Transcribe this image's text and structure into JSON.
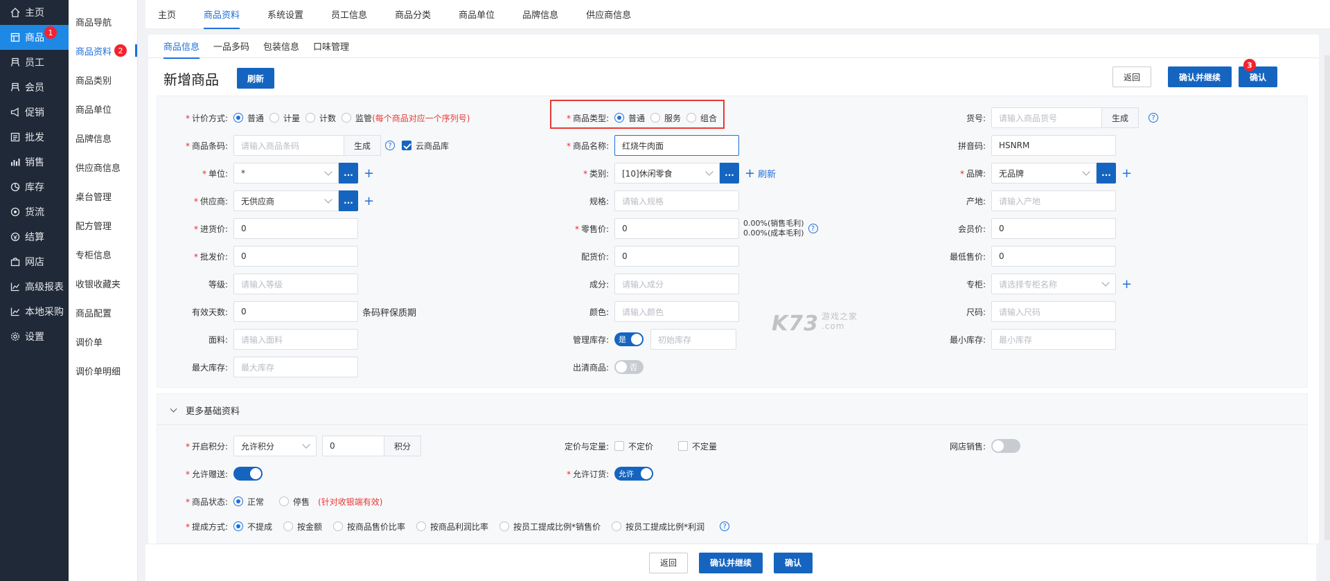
{
  "sidebar": {
    "items": [
      {
        "label": "主页",
        "icon": "home-icon"
      },
      {
        "label": "商品",
        "icon": "goods-icon",
        "badge": "1"
      },
      {
        "label": "员工",
        "icon": "staff-icon"
      },
      {
        "label": "会员",
        "icon": "member-icon"
      },
      {
        "label": "促销",
        "icon": "promotion-icon"
      },
      {
        "label": "批发",
        "icon": "wholesale-icon"
      },
      {
        "label": "销售",
        "icon": "sales-icon"
      },
      {
        "label": "库存",
        "icon": "inventory-icon"
      },
      {
        "label": "货流",
        "icon": "logistics-icon"
      },
      {
        "label": "结算",
        "icon": "settlement-icon"
      },
      {
        "label": "网店",
        "icon": "shop-icon"
      },
      {
        "label": "高级报表",
        "icon": "report-icon"
      },
      {
        "label": "本地采购",
        "icon": "purchase-icon"
      },
      {
        "label": "设置",
        "icon": "settings-icon"
      }
    ]
  },
  "subnav": {
    "items": [
      "商品导航",
      "商品资料",
      "商品类别",
      "商品单位",
      "品牌信息",
      "供应商信息",
      "桌台管理",
      "配方管理",
      "专柜信息",
      "收银收藏夹",
      "商品配置",
      "调价单",
      "调价单明细"
    ],
    "badge": "2"
  },
  "topnav": {
    "items": [
      "主页",
      "商品资料",
      "系统设置",
      "员工信息",
      "商品分类",
      "商品单位",
      "品牌信息",
      "供应商信息"
    ]
  },
  "subtabs": [
    "商品信息",
    "一品多码",
    "包装信息",
    "口味管理"
  ],
  "header": {
    "title": "新增商品",
    "refresh": "刷新",
    "back": "返回",
    "confirm_continue": "确认并继续",
    "confirm": "确认",
    "confirm_badge": "3"
  },
  "form": {
    "pricing_label": "计价方式:",
    "pricing_options": [
      "普通",
      "计量",
      "计数",
      "监管"
    ],
    "pricing_note": "(每个商品对应一个序列号)",
    "type_label": "商品类型:",
    "type_options": [
      "普通",
      "服务",
      "组合"
    ],
    "sku_label": "货号:",
    "sku_placeholder": "请输入商品货号",
    "generate": "生成",
    "barcode_label": "商品条码:",
    "barcode_placeholder": "请输入商品条码",
    "cloud_lib": "云商品库",
    "name_label": "商品名称:",
    "name_value": "红烧牛肉面",
    "pinyin_label": "拼音码:",
    "pinyin_value": "HSNRM",
    "unit_label": "单位:",
    "unit_value": "*",
    "more_btn": "...",
    "category_label": "类别:",
    "category_value": "[10]休闲零食",
    "category_refresh": "刷新",
    "brand_label": "品牌:",
    "brand_value": "无品牌",
    "supplier_label": "供应商:",
    "supplier_value": "无供应商",
    "spec_label": "规格:",
    "spec_placeholder": "请输入规格",
    "origin_label": "产地:",
    "origin_placeholder": "请输入产地",
    "purchase_label": "进货价:",
    "purchase_value": "0",
    "retail_label": "零售价:",
    "retail_value": "0",
    "margin1": "0.00%(销售毛利)",
    "margin2": "0.00%(成本毛利)",
    "member_label": "会员价:",
    "member_value": "0",
    "wholesale_label": "批发价:",
    "wholesale_value": "0",
    "delivery_label": "配货价:",
    "delivery_value": "0",
    "lowest_label": "最低售价:",
    "lowest_value": "0",
    "grade_label": "等级:",
    "grade_placeholder": "请输入等级",
    "ingredient_label": "成分:",
    "ingredient_placeholder": "请输入成分",
    "counter_label": "专柜:",
    "counter_placeholder": "请选择专柜名称",
    "shelf_label": "有效天数:",
    "shelf_value": "0",
    "shelf_note": "条码秤保质期",
    "color_label": "颜色:",
    "color_placeholder": "请输入颜色",
    "size_label": "尺码:",
    "size_placeholder": "请输入尺码",
    "fabric_label": "面料:",
    "fabric_placeholder": "请输入面料",
    "manage_stock_label": "管理库存:",
    "manage_stock_toggle": "是",
    "init_stock_placeholder": "初始库存",
    "min_stock_label": "最小库存:",
    "min_stock_placeholder": "最小库存",
    "max_stock_label": "最大库存:",
    "max_stock_placeholder": "最大库存",
    "clearance_label": "出清商品:",
    "clearance_toggle": "否"
  },
  "more": {
    "title": "更多基础资料",
    "points_label": "开启积分:",
    "points_select": "允许积分",
    "points_value": "0",
    "points_unit": "积分",
    "fixed_label": "定价与定量:",
    "fixed_price": "不定价",
    "fixed_qty": "不定量",
    "online_label": "网店销售:",
    "gift_label": "允许赠送:",
    "order_label": "允许订货:",
    "order_toggle": "允许",
    "status_label": "商品状态:",
    "status_options": [
      "正常",
      "停售"
    ],
    "status_note": "(针对收银端有效)",
    "commission_label": "提成方式:",
    "commission_options": [
      "不提成",
      "按金额",
      "按商品售价比率",
      "按商品利润比率",
      "按员工提成比例*销售价",
      "按员工提成比例*利润"
    ]
  },
  "footer": {
    "back": "返回",
    "confirm_continue": "确认并继续",
    "confirm": "确认"
  },
  "watermark": {
    "text": "K73",
    "sub1": "游戏之家",
    "sub2": ".com"
  },
  "colors": {
    "accent": "#1565c0",
    "sidebar_bg": "#1f2937",
    "highlight": "#e53935"
  }
}
